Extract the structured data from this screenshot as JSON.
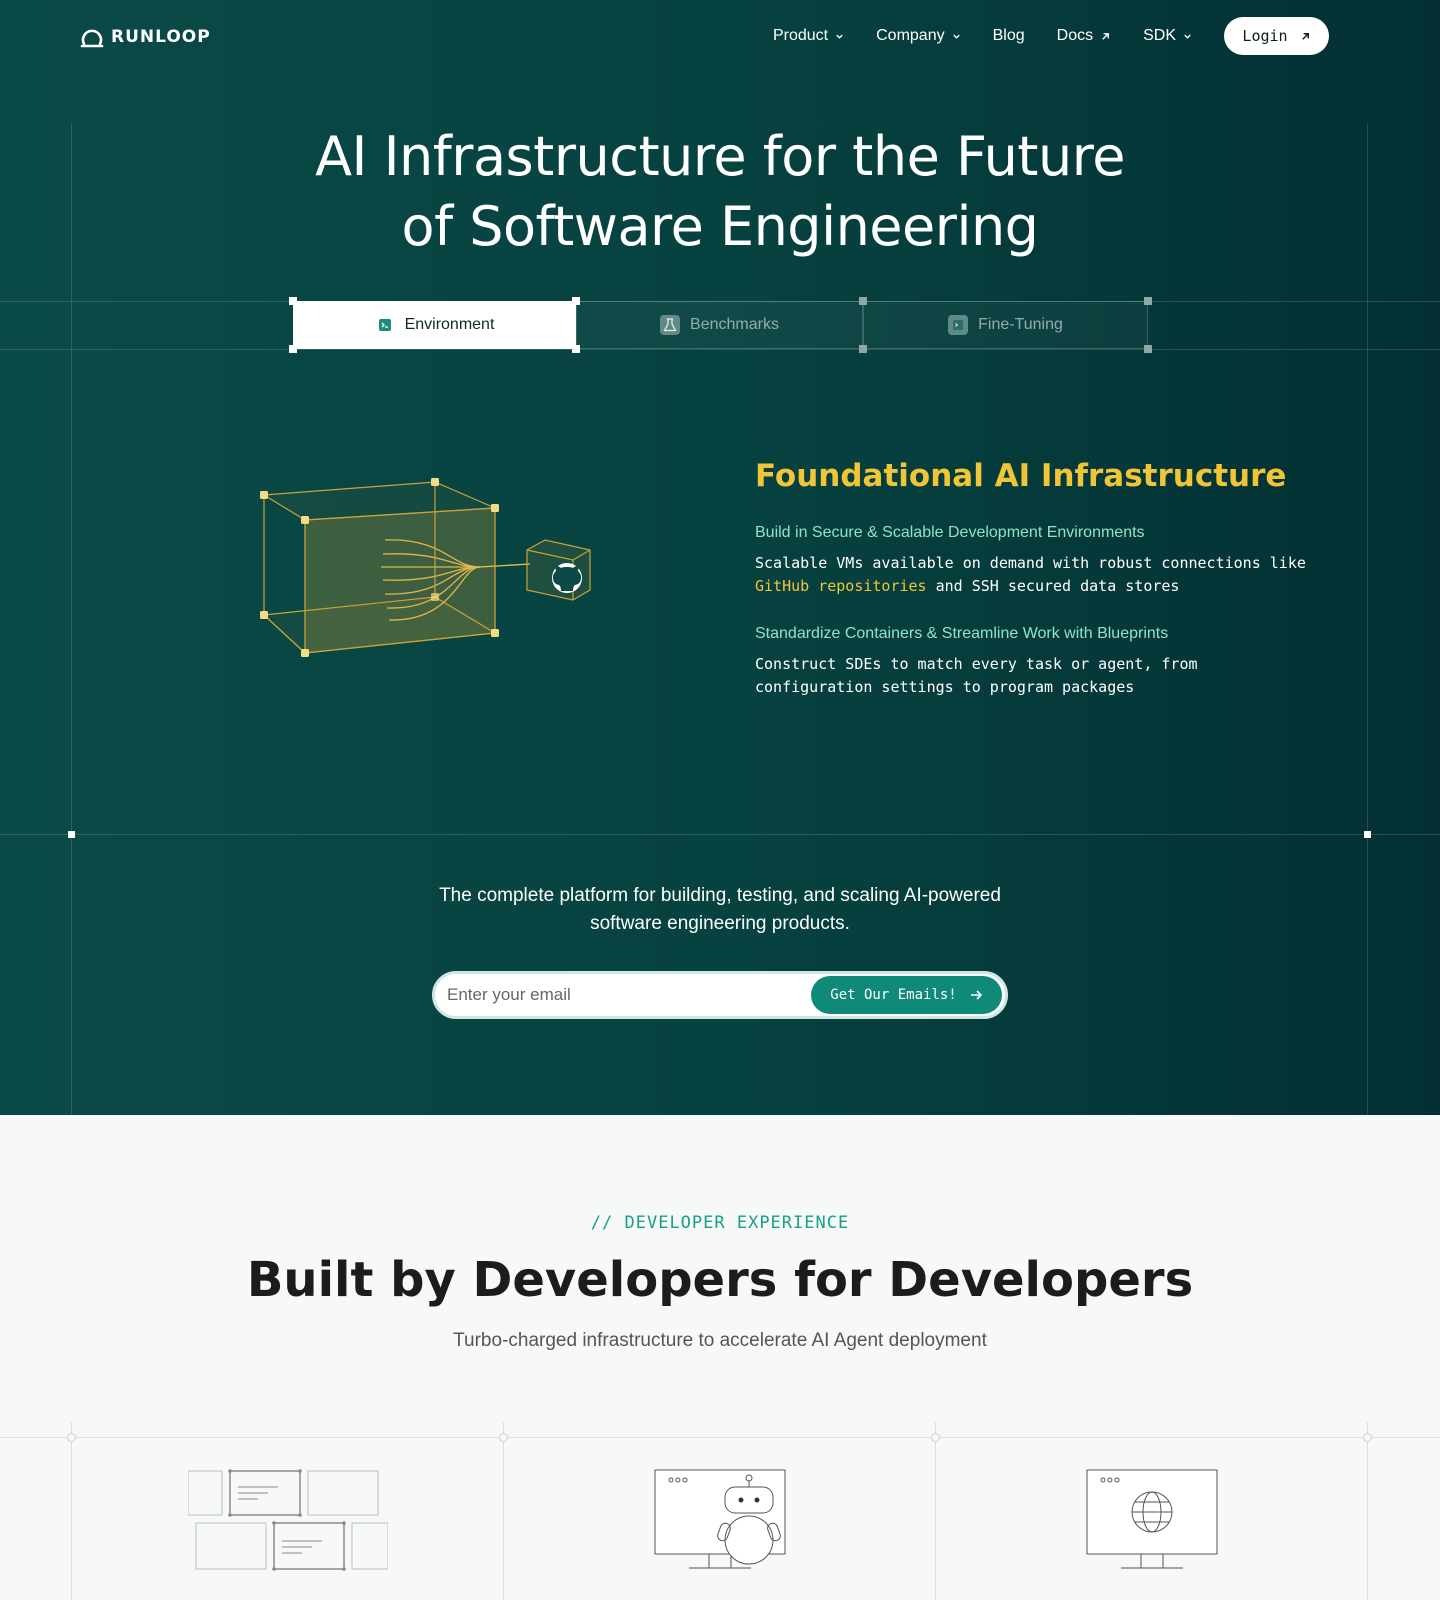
{
  "brand": {
    "name": "RUNLOOP"
  },
  "nav": {
    "items": [
      {
        "label": "Product",
        "icon": "chevron-down-icon"
      },
      {
        "label": "Company",
        "icon": "chevron-down-icon"
      },
      {
        "label": "Blog"
      },
      {
        "label": "Docs",
        "icon": "external-arrow-icon"
      },
      {
        "label": "SDK",
        "icon": "chevron-down-icon"
      }
    ],
    "login_label": "Login"
  },
  "hero": {
    "title_line1": "AI Infrastructure for the Future",
    "title_line2": "of Software Engineering"
  },
  "tabs": [
    {
      "label": "Environment",
      "active": true,
      "icon": "terminal-icon"
    },
    {
      "label": "Benchmarks",
      "active": false,
      "icon": "flask-icon"
    },
    {
      "label": "Fine-Tuning",
      "active": false,
      "icon": "terminal-icon"
    }
  ],
  "feature": {
    "title": "Foundational AI Infrastructure",
    "items": [
      {
        "subtitle": "Build in Secure & Scalable Development Environments",
        "body_line1": "Scalable VMs available on demand with robust connections like",
        "body_highlight": "GitHub repositories",
        "body_rest": " and SSH secured data stores"
      },
      {
        "subtitle": "Standardize Containers & Streamline Work with Blueprints",
        "body_line1": "Construct SDEs to match every task or agent, from",
        "body_line2": "configuration settings to program packages"
      }
    ]
  },
  "signup": {
    "tagline_line1": "The complete platform for building, testing, and scaling AI-powered",
    "tagline_line2": "software engineering products.",
    "email_placeholder": "Enter your email",
    "cta_label": "Get Our Emails!"
  },
  "developer": {
    "eyebrow": "// DEVELOPER EXPERIENCE",
    "title": "Built by Developers for Developers",
    "subtitle": "Turbo-charged infrastructure to accelerate AI Agent deployment"
  },
  "colors": {
    "hero_bg": "#06413f",
    "accent_yellow": "#f2c437",
    "accent_mint": "#8fe3c9",
    "cta_green": "#0f8a78",
    "eyebrow_green": "#17a088"
  }
}
